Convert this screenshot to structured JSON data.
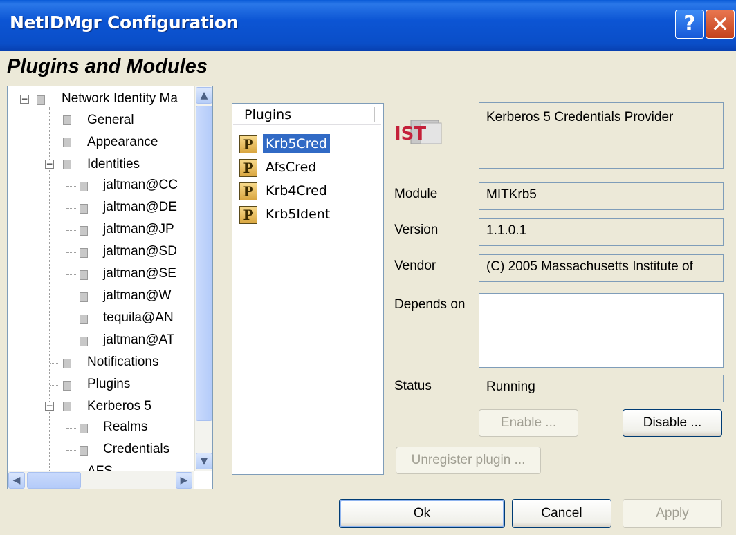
{
  "window": {
    "title": "NetIDMgr Configuration",
    "help_label": "?",
    "close_label": "✕"
  },
  "page_heading": "Plugins and Modules",
  "tree": {
    "root": "Network Identity Ma",
    "general": "General",
    "appearance": "Appearance",
    "identities": "Identities",
    "identity_items": [
      "jaltman@CC",
      "jaltman@DE",
      "jaltman@JP",
      "jaltman@SD",
      "jaltman@SE",
      "jaltman@W",
      "tequila@AN",
      "jaltman@AT"
    ],
    "notifications": "Notifications",
    "plugins": "Plugins",
    "kerberos5": "Kerberos 5",
    "realms": "Realms",
    "credentials": "Credentials",
    "afs": "AFS"
  },
  "plugins_list": {
    "header": "Plugins",
    "icon_glyph": "P",
    "items": [
      "Krb5Cred",
      "AfsCred",
      "Krb4Cred",
      "Krb5Ident"
    ],
    "selected": "Krb5Cred"
  },
  "details": {
    "description": "Kerberos 5 Credentials Provider",
    "module_label": "Module",
    "module_value": "MITKrb5",
    "version_label": "Version",
    "version_value": "1.1.0.1",
    "vendor_label": "Vendor",
    "vendor_value": "(C) 2005 Massachusetts Institute of",
    "depends_label": "Depends on",
    "depends_value": "",
    "status_label": "Status",
    "status_value": "Running",
    "logo_text": "IST"
  },
  "buttons": {
    "enable": "Enable ...",
    "disable": "Disable ...",
    "unregister": "Unregister plugin ...",
    "ok": "Ok",
    "cancel": "Cancel",
    "apply": "Apply"
  },
  "colors": {
    "selection": "#316ac5",
    "titlebar": "#0a4ec8",
    "dialog_bg": "#ece9d8"
  }
}
